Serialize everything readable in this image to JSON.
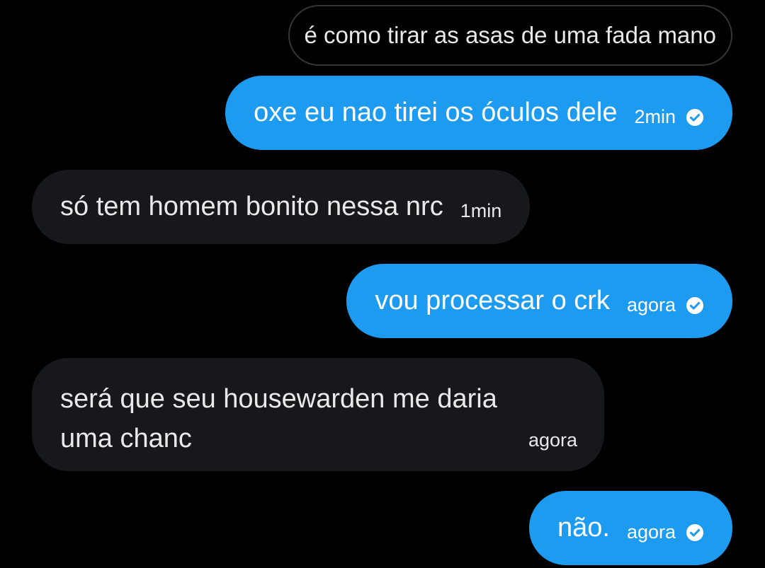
{
  "thread": {
    "reply_quote": "é como tirar as asas de uma fada mano",
    "messages": [
      {
        "side": "sent",
        "text": "oxe eu nao tirei os óculos dele",
        "time": "2min",
        "status": "seen"
      },
      {
        "side": "received",
        "text": "só tem homem bonito nessa nrc",
        "time": "1min"
      },
      {
        "side": "sent",
        "text": "vou processar o crk",
        "time": "agora",
        "status": "seen"
      },
      {
        "side": "received",
        "text_line1": "será que seu housewarden me daria",
        "text_line2": "uma chanc",
        "time": "agora"
      },
      {
        "side": "sent",
        "text": "não.",
        "time": "agora",
        "status": "seen"
      }
    ]
  },
  "colors": {
    "background": "#000000",
    "sent_bubble": "#1d9bf0",
    "received_bubble": "#16181c",
    "quote_border": "#333639",
    "text_light": "#e7e9ea"
  },
  "icons": {
    "seen": "check-circle-icon"
  }
}
